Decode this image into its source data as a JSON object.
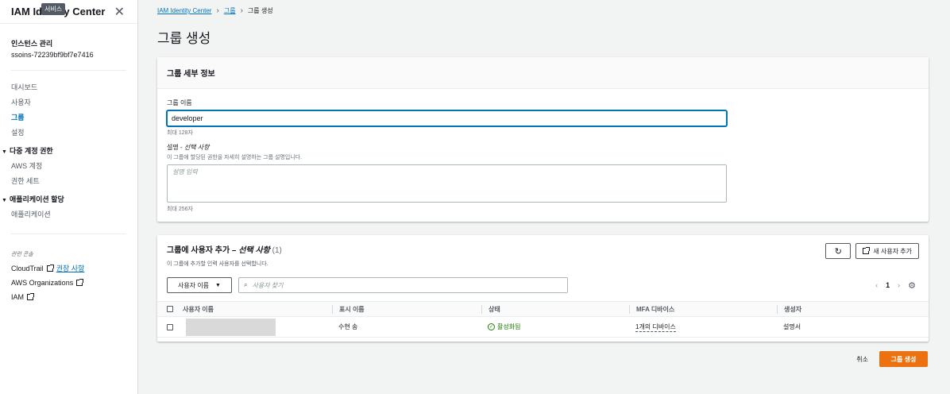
{
  "sidebar": {
    "title": "IAM Identity Center",
    "tooltip": "서비스",
    "close": "✕",
    "instance_label": "인스턴스 관리",
    "instance_id": "ssoins-72239bf9bf7e7416",
    "items": [
      "대시보드",
      "사용자",
      "그룹",
      "설정"
    ],
    "section_multi": "다중 계정 권한",
    "multi_items": [
      "AWS 계정",
      "권한 세트"
    ],
    "section_apps": "애플리케이션 할당",
    "app_items": [
      "애플리케이션"
    ],
    "related_caption": "관련 콘솔",
    "related": [
      {
        "label": "CloudTrail",
        "badge": "권장 사항"
      },
      {
        "label": "AWS Organizations"
      },
      {
        "label": "IAM"
      }
    ]
  },
  "breadcrumb": [
    "IAM Identity Center",
    "그룹",
    "그룹 생성"
  ],
  "page_title": "그룹 생성",
  "details": {
    "heading": "그룹 세부 정보",
    "name_label": "그룹 이름",
    "name_value": "developer",
    "name_constraint": "최대 128자",
    "desc_label": "설명 - ",
    "desc_optional": "선택 사항",
    "desc_hint": "이 그룹에 할당된 권한을 자세히 설명하는 그룹 설명입니다.",
    "desc_placeholder": "설명 입력",
    "desc_constraint": "최대 256자"
  },
  "users": {
    "heading": "그룹에 사용자 추가 – ",
    "heading_optional": "선택 사항",
    "count": "(1)",
    "desc": "이 그룹에 추가할 인력 사용자를 선택합니다.",
    "refresh_icon": "refresh-icon",
    "add_user_label": "새 사용자 추가",
    "filter_label": "사용자 이름",
    "search_placeholder": "사용자 찾기",
    "page": "1",
    "columns": [
      "사용자 이름",
      "표시 이름",
      "상태",
      "MFA 디바이스",
      "생성자"
    ],
    "rows": [
      {
        "display_name": "수현 송",
        "status": "활성화됨",
        "mfa": "1개의 디바이스",
        "created_by": "설명서"
      }
    ]
  },
  "actions": {
    "cancel": "취소",
    "create": "그룹 생성"
  },
  "colors": {
    "link": "#0073bb",
    "primary": "#ec7211",
    "success": "#1d8102"
  }
}
